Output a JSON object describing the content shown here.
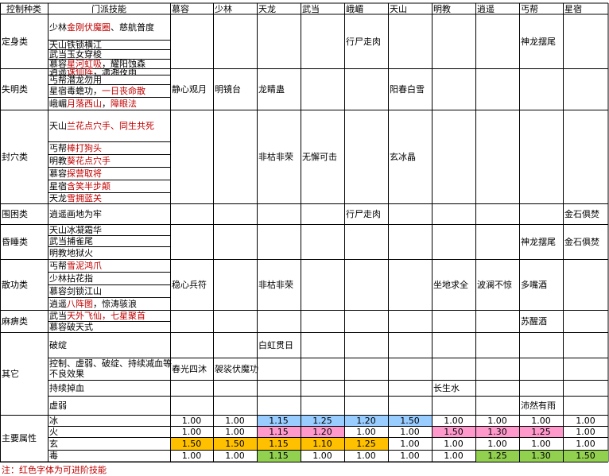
{
  "headers": [
    "控制种类",
    "门派技能",
    "慕容",
    "少林",
    "天龙",
    "武当",
    "峨嵋",
    "天山",
    "明教",
    "逍遥",
    "丐帮",
    "星宿"
  ],
  "categories": [
    {
      "label": "定身类"
    },
    {
      "label": "失明类"
    },
    {
      "label": "封穴类"
    },
    {
      "label": "围困类"
    },
    {
      "label": "昏睡类"
    },
    {
      "label": "散功类"
    },
    {
      "label": "麻痹类"
    },
    {
      "label": "其它"
    },
    {
      "label": "主要属性"
    }
  ],
  "skills": [
    [
      {
        "t": "少林"
      },
      {
        "t": "金刚伏魔圈",
        "r": 1
      },
      {
        "t": "、慈航普度"
      }
    ],
    [
      {
        "t": "天山铁锁横江"
      }
    ],
    [
      {
        "t": "武当玉女穿梭"
      }
    ],
    [
      {
        "t": "慕容"
      },
      {
        "t": "星河虹吸",
        "r": 1
      },
      {
        "t": "，耀阳蚀森"
      }
    ],
    [
      {
        "t": "逍遥"
      },
      {
        "t": "诛仙阵",
        "r": 1
      },
      {
        "t": "，潇湘夜雨"
      }
    ],
    [
      {
        "t": "丐帮潜龙勿用"
      }
    ],
    [
      {
        "t": "星宿毒蟾功，"
      },
      {
        "t": "一日丧命散",
        "r": 1
      }
    ],
    [
      {
        "t": "峨嵋"
      },
      {
        "t": "月落西山",
        "r": 1
      },
      {
        "t": "，"
      },
      {
        "t": "障眼法",
        "r": 1
      }
    ],
    [
      {
        "t": "天山"
      },
      {
        "t": "兰花点穴手、同生共死",
        "r": 1
      }
    ],
    [
      {
        "t": "丐帮"
      },
      {
        "t": "棒打狗头",
        "r": 1
      }
    ],
    [
      {
        "t": "明教"
      },
      {
        "t": "葵花点穴手",
        "r": 1
      }
    ],
    [
      {
        "t": "慕容"
      },
      {
        "t": "探营取将",
        "r": 1
      }
    ],
    [
      {
        "t": "星宿"
      },
      {
        "t": "含笑半步颠",
        "r": 1
      }
    ],
    [
      {
        "t": "天龙"
      },
      {
        "t": "雪拥蓝关",
        "r": 1
      }
    ],
    [
      {
        "t": "逍遥画地为牢"
      }
    ],
    [
      {
        "t": "天山冰凝霜华"
      }
    ],
    [
      {
        "t": "武当捕雀尾"
      }
    ],
    [
      {
        "t": "明教地狱火"
      }
    ],
    [
      {
        "t": "丐帮"
      },
      {
        "t": "雪泥鸿爪",
        "r": 1
      }
    ],
    [
      {
        "t": "少林拈花指"
      }
    ],
    [
      {
        "t": "慕容剑锁江山"
      }
    ],
    [
      {
        "t": "逍遥"
      },
      {
        "t": "八阵图",
        "r": 1
      },
      {
        "t": "，惊涛骇浪"
      }
    ],
    [
      {
        "t": "武当"
      },
      {
        "t": "天外飞仙，七星聚首",
        "r": 1
      }
    ],
    [
      {
        "t": "慕容破天式"
      }
    ],
    [
      {
        "t": "破绽"
      }
    ],
    [
      {
        "t": "控制、虚弱、破绽、持续减血等不良效果"
      }
    ],
    [
      {
        "t": "持续掉血"
      }
    ],
    [
      {
        "t": "虚弱"
      }
    ],
    [
      {
        "t": "冰"
      }
    ],
    [
      {
        "t": "火"
      }
    ],
    [
      {
        "t": "玄"
      }
    ],
    [
      {
        "t": "毒"
      }
    ]
  ],
  "cells": [
    {
      "key": "ding-ermei",
      "text": "行尸走肉"
    },
    {
      "key": "ding-gaibang",
      "text": "神龙摆尾"
    },
    {
      "key": "shi-murong",
      "text": "静心观月"
    },
    {
      "key": "shi-shaolin",
      "text": "明镜台"
    },
    {
      "key": "shi-tianlong",
      "text": "龙睛蛊"
    },
    {
      "key": "shi-tianshan",
      "text": "阳春白雪"
    },
    {
      "key": "feng-tianlong",
      "text": "非枯非荣"
    },
    {
      "key": "feng-wudang",
      "text": "无懈可击"
    },
    {
      "key": "feng-tianshan",
      "text": "玄冰晶"
    },
    {
      "key": "wei-ermei",
      "text": "行尸走肉"
    },
    {
      "key": "wei-xingxiu",
      "text": "金石俱焚"
    },
    {
      "key": "hun-gaibang",
      "text": "神龙摆尾"
    },
    {
      "key": "hun-xingxiu",
      "text": "金石俱焚"
    },
    {
      "key": "san-murong",
      "text": "稳心兵符"
    },
    {
      "key": "san-tianlong",
      "text": "非枯非荣"
    },
    {
      "key": "san-mingjiao",
      "text": "坐地求全"
    },
    {
      "key": "san-xiaoyao",
      "text": "波澜不惊"
    },
    {
      "key": "san-gaibang",
      "text": "多嘴酒"
    },
    {
      "key": "ma-gaibang",
      "text": "苏醒酒"
    },
    {
      "key": "qi-tianlong",
      "text": "白虹贯日"
    },
    {
      "key": "qi-murong",
      "text": "春光四沐"
    },
    {
      "key": "qi-shaolin",
      "text": "袈裟伏魔功"
    },
    {
      "key": "qi-mingjiao",
      "text": "长生水"
    },
    {
      "key": "qi-gaibang",
      "text": "沛然有雨"
    }
  ],
  "attributes": [
    {
      "name": "冰",
      "values": [
        "1.00",
        "1.00",
        "1.15",
        "1.25",
        "1.20",
        "1.50",
        "1.00",
        "1.00",
        "1.00",
        "1.00"
      ]
    },
    {
      "name": "火",
      "values": [
        "1.00",
        "1.00",
        "1.15",
        "1.20",
        "1.00",
        "1.00",
        "1.50",
        "1.30",
        "1.25",
        "1.00"
      ]
    },
    {
      "name": "玄",
      "values": [
        "1.50",
        "1.50",
        "1.15",
        "1.10",
        "1.25",
        "1.00",
        "1.00",
        "1.00",
        "1.00",
        "1.00"
      ]
    },
    {
      "name": "毒",
      "values": [
        "1.00",
        "1.00",
        "1.15",
        "1.00",
        "1.00",
        "1.00",
        "1.00",
        "1.25",
        "1.30",
        "1.50"
      ]
    }
  ],
  "highlight_colors": {
    "ice": "#99ccff",
    "fire": "#ff99cc",
    "xuan": "#ffc000",
    "poison": "#92d050",
    "text_red": "#c00000",
    "grid": "#000000"
  },
  "note": "注：红色字体为可进阶技能"
}
